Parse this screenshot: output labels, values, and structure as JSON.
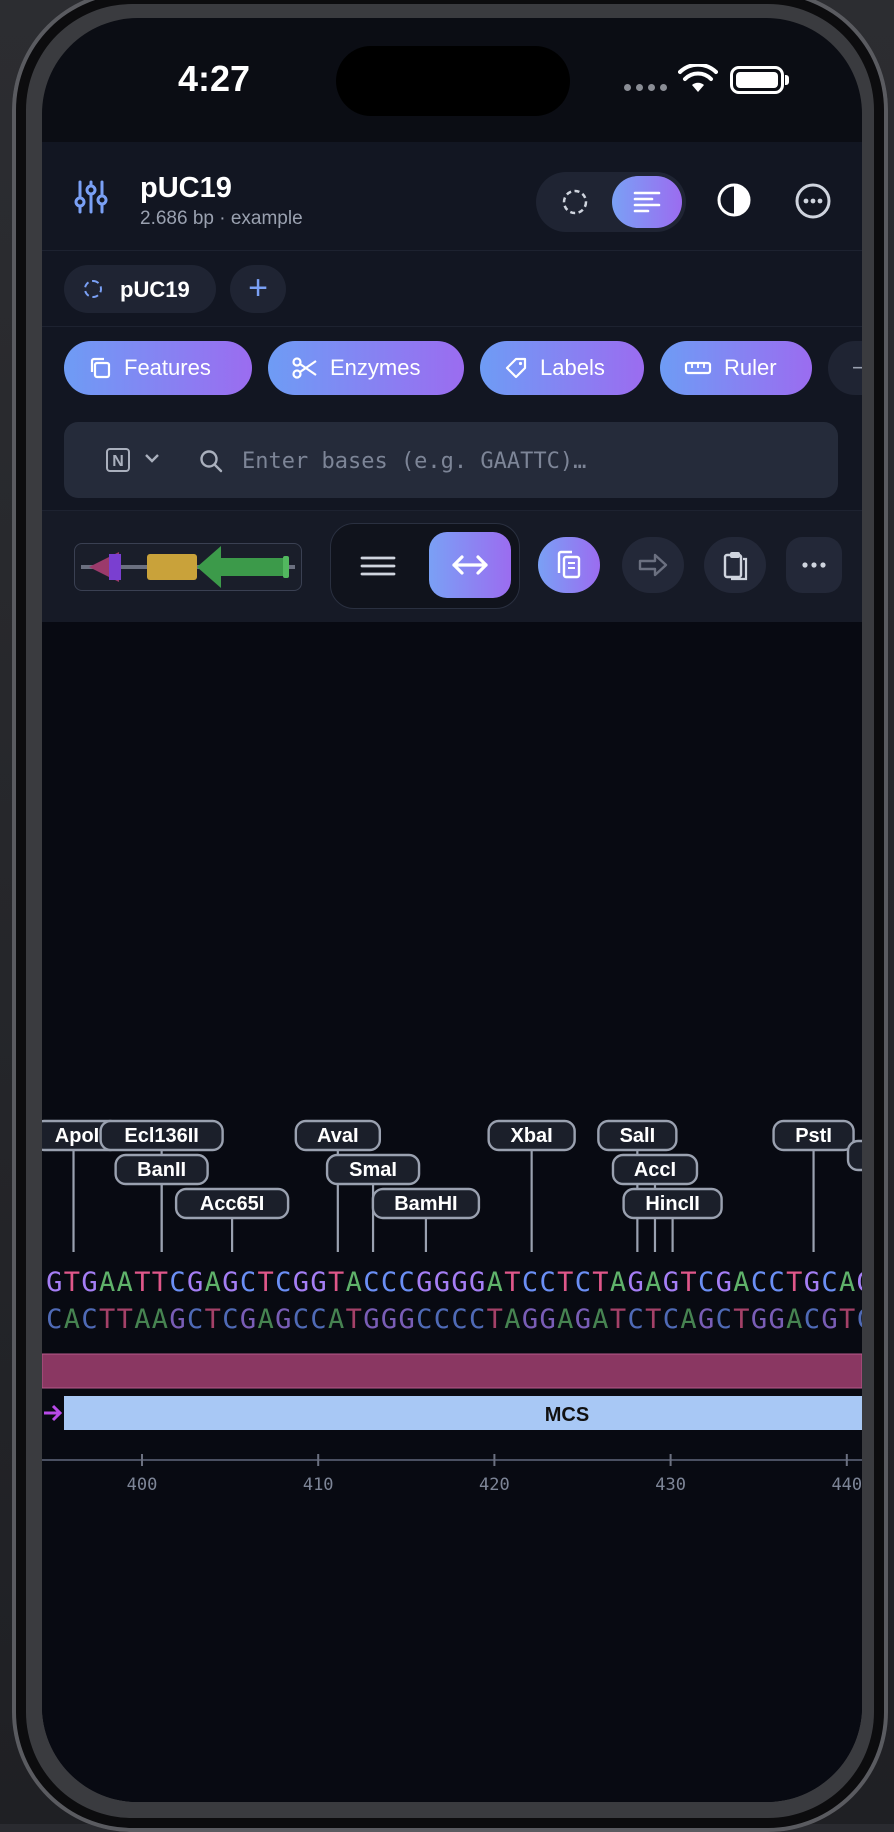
{
  "status": {
    "time": "4:27"
  },
  "header": {
    "title": "pUC19",
    "subtitle": "2.686 bp · example"
  },
  "tabs": [
    {
      "label": "pUC19"
    }
  ],
  "chips": [
    {
      "label": "Features",
      "icon": "copy-icon"
    },
    {
      "label": "Enzymes",
      "icon": "scissors-icon"
    },
    {
      "label": "Labels",
      "icon": "tag-icon"
    },
    {
      "label": "Ruler",
      "icon": "ruler-icon"
    }
  ],
  "search": {
    "placeholder": "Enter bases (e.g. GAATTC)…",
    "mode": "N"
  },
  "enzymes": [
    {
      "name": "ApoI",
      "pos": 397
    },
    {
      "name": "Ecl136II",
      "pos": 402
    },
    {
      "name": "BanII",
      "pos": 402
    },
    {
      "name": "Acc65I",
      "pos": 406
    },
    {
      "name": "AvaI",
      "pos": 412
    },
    {
      "name": "SmaI",
      "pos": 414
    },
    {
      "name": "BamHI",
      "pos": 417
    },
    {
      "name": "XbaI",
      "pos": 423
    },
    {
      "name": "SalI",
      "pos": 429
    },
    {
      "name": "AccI",
      "pos": 430
    },
    {
      "name": "HincII",
      "pos": 431
    },
    {
      "name": "PstI",
      "pos": 439
    }
  ],
  "sequence": {
    "top": "GTGAATTCGAGCTCGGTACCCGGGGATCCTCTAGAGTCGACCTGCAGG",
    "bottom": "CACTTAAGCTCGAGCCATGGGCCCCTAGGAGATCTCAGCTGGACGTCC",
    "start": 394.5
  },
  "features": [
    {
      "name": "MCS",
      "color": "#a8c8f5"
    }
  ],
  "ruler": {
    "ticks": [
      400,
      410,
      420,
      430,
      440
    ]
  },
  "colors": {
    "accent_start": "#7aa0f5",
    "accent_end": "#9b6cf0",
    "A": "#5fb26a",
    "T": "#e0578a",
    "G": "#a57ef5",
    "C": "#6b8ff5"
  }
}
